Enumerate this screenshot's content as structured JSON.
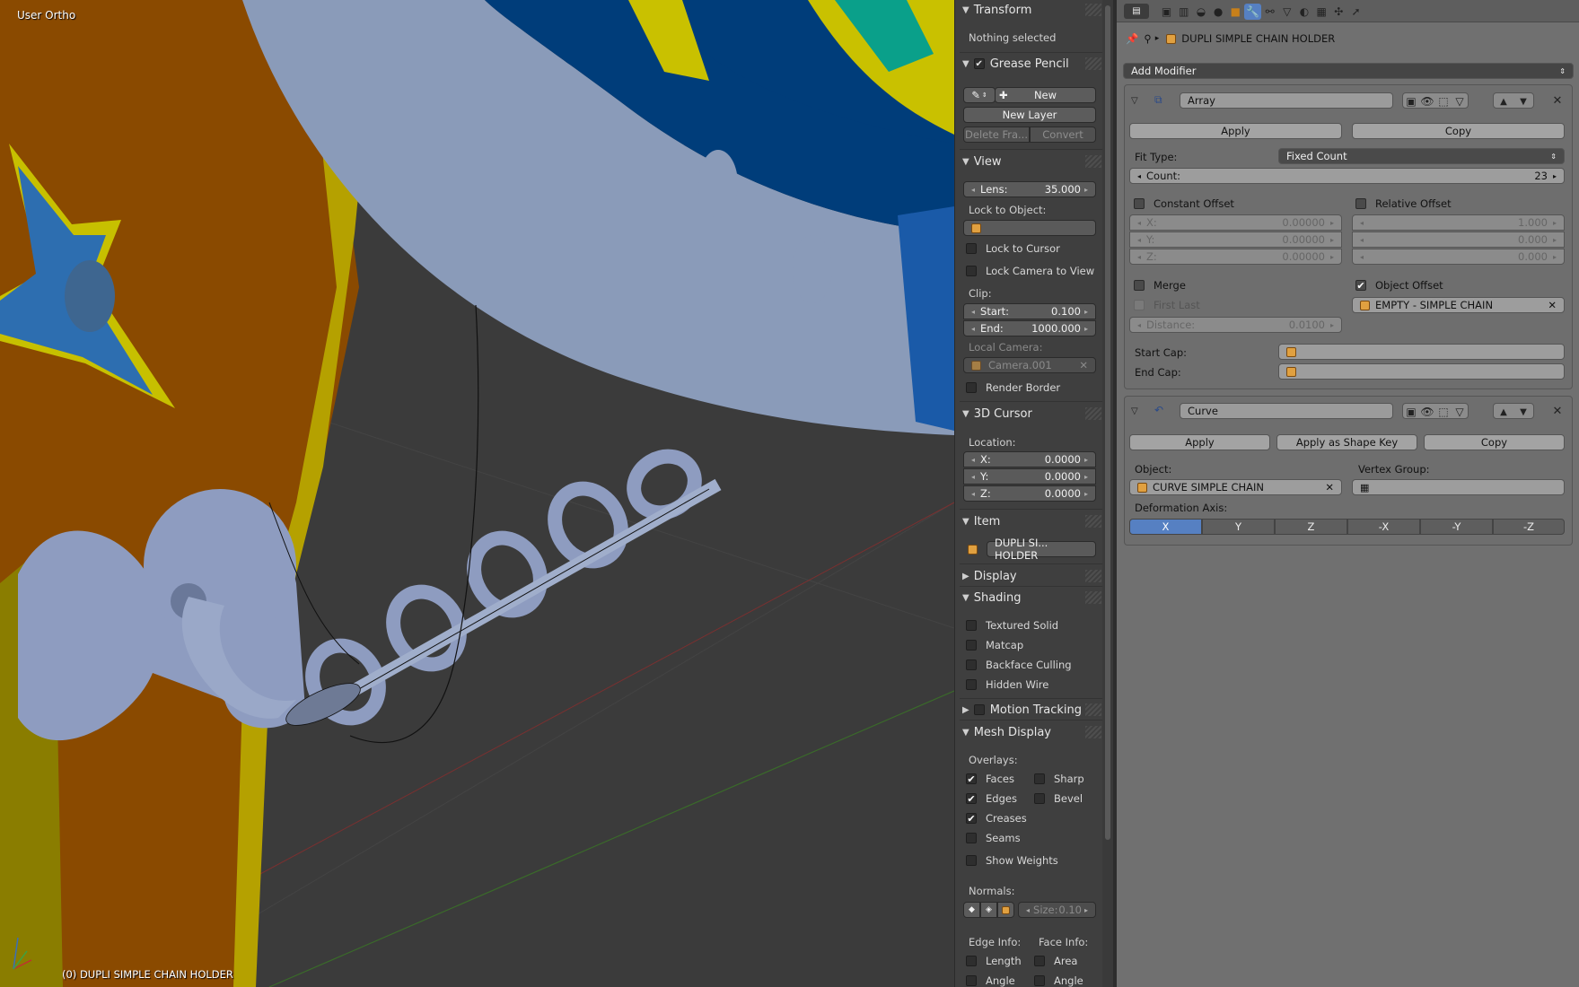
{
  "viewport": {
    "mode_label": "User Ortho",
    "object_label": "(0) DUPLI SIMPLE CHAIN HOLDER"
  },
  "npanel": {
    "transform": {
      "title": "Transform",
      "status": "Nothing selected"
    },
    "grease_pencil": {
      "title": "Grease Pencil",
      "enabled": true,
      "new_label": "New",
      "new_layer_label": "New Layer",
      "delete_frame_label": "Delete Fra...",
      "convert_label": "Convert"
    },
    "view": {
      "title": "View",
      "lens_label": "Lens:",
      "lens_value": "35.000",
      "lock_to_object_label": "Lock to Object:",
      "lock_to_cursor_label": "Lock to Cursor",
      "lock_camera_label": "Lock Camera to View",
      "clip_label": "Clip:",
      "clip_start_label": "Start:",
      "clip_start_value": "0.100",
      "clip_end_label": "End:",
      "clip_end_value": "1000.000",
      "local_camera_label": "Local Camera:",
      "local_camera_value": "Camera.001",
      "render_border_label": "Render Border"
    },
    "cursor": {
      "title": "3D Cursor",
      "location_label": "Location:",
      "x_label": "X:",
      "x_value": "0.0000",
      "y_label": "Y:",
      "y_value": "0.0000",
      "z_label": "Z:",
      "z_value": "0.0000"
    },
    "item": {
      "title": "Item",
      "name": "DUPLI SI... HOLDER"
    },
    "display": {
      "title": "Display"
    },
    "shading": {
      "title": "Shading",
      "textured_solid": "Textured Solid",
      "matcap": "Matcap",
      "backface_culling": "Backface Culling",
      "hidden_wire": "Hidden Wire"
    },
    "motion_tracking": {
      "title": "Motion Tracking"
    },
    "mesh_display": {
      "title": "Mesh Display",
      "overlays_label": "Overlays:",
      "faces": "Faces",
      "sharp": "Sharp",
      "edges": "Edges",
      "bevel": "Bevel",
      "creases": "Creases",
      "seams": "Seams",
      "show_weights": "Show Weights",
      "normals_label": "Normals:",
      "size_label": "Size:",
      "size_value": "0.10",
      "edge_info_label": "Edge Info:",
      "face_info_label": "Face Info:",
      "length": "Length",
      "area": "Area",
      "edge_angle": "Angle",
      "face_angle": "Angle"
    }
  },
  "properties": {
    "breadcrumb_object": "DUPLI SIMPLE CHAIN HOLDER",
    "add_modifier_label": "Add Modifier",
    "array": {
      "name": "Array",
      "apply_label": "Apply",
      "copy_label": "Copy",
      "fit_type_label": "Fit Type:",
      "fit_type_value": "Fixed Count",
      "count_label": "Count:",
      "count_value": "23",
      "constant_offset_label": "Constant Offset",
      "relative_offset_label": "Relative Offset",
      "const_x_label": "X:",
      "const_x": "0.00000",
      "const_y_label": "Y:",
      "const_y": "0.00000",
      "const_z_label": "Z:",
      "const_z": "0.00000",
      "rel_x": "1.000",
      "rel_y": "0.000",
      "rel_z": "0.000",
      "merge_label": "Merge",
      "first_last_label": "First Last",
      "distance_label": "Distance:",
      "distance_value": "0.0100",
      "object_offset_label": "Object Offset",
      "object_offset_value": "EMPTY - SIMPLE CHAIN",
      "start_cap_label": "Start Cap:",
      "end_cap_label": "End Cap:"
    },
    "curve": {
      "name": "Curve",
      "apply_label": "Apply",
      "apply_shape_label": "Apply as Shape Key",
      "copy_label": "Copy",
      "object_label": "Object:",
      "object_value": "CURVE SIMPLE CHAIN",
      "vertex_group_label": "Vertex Group:",
      "deformation_axis_label": "Deformation Axis:",
      "axes": [
        "X",
        "Y",
        "Z",
        "-X",
        "-Y",
        "-Z"
      ],
      "selected_axis": "X"
    }
  },
  "colors": {
    "selected_axis": "#5680c2",
    "viewport_bg": "#3a3a3a",
    "properties_bg": "#707070"
  }
}
